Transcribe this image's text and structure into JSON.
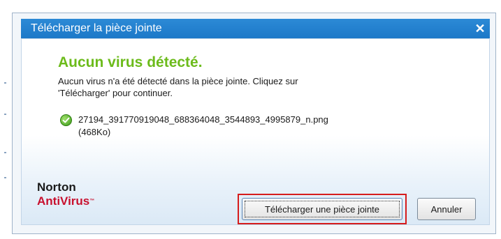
{
  "dialog": {
    "title": "Télécharger la pièce jointe",
    "close_glyph": "✕",
    "headline": "Aucun virus détecté.",
    "message_line1": "Aucun virus n'a été détecté dans la pièce jointe. Cliquez sur",
    "message_line2": "'Télécharger' pour continuer.",
    "file_name": "27194_391770919048_688364048_3544893_4995879_n.png",
    "file_size": "(468Ko)",
    "file_status_icon": "check-icon"
  },
  "brand": {
    "line1": "Norton",
    "line2": "AntiVirus",
    "accent_color": "#c8102e"
  },
  "buttons": {
    "download_label": "Télécharger une pièce jointe",
    "cancel_label": "Annuler"
  },
  "colors": {
    "titlebar": "#1c78c8",
    "headline": "#6cbb1b",
    "highlight": "#d61c1c"
  }
}
